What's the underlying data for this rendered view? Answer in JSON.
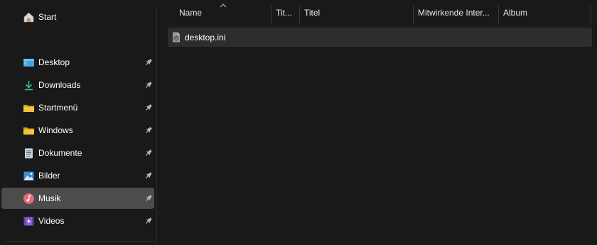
{
  "sidebar": {
    "home": {
      "label": "Start",
      "icon": "home-icon"
    },
    "items": [
      {
        "label": "Desktop",
        "icon": "desktop-icon",
        "pinned": true,
        "selected": false
      },
      {
        "label": "Downloads",
        "icon": "download-icon",
        "pinned": true,
        "selected": false
      },
      {
        "label": "Startmenü",
        "icon": "folder-icon",
        "pinned": true,
        "selected": false
      },
      {
        "label": "Windows",
        "icon": "folder-icon",
        "pinned": true,
        "selected": false
      },
      {
        "label": "Dokumente",
        "icon": "documents-icon",
        "pinned": true,
        "selected": false
      },
      {
        "label": "Bilder",
        "icon": "pictures-icon",
        "pinned": true,
        "selected": false
      },
      {
        "label": "Musik",
        "icon": "music-icon",
        "pinned": true,
        "selected": true
      },
      {
        "label": "Videos",
        "icon": "videos-icon",
        "pinned": true,
        "selected": false
      }
    ]
  },
  "columns": {
    "name": "Name",
    "track_number": "Tit...",
    "title": "Titel",
    "contributing_artists": "Mitwirkende Inter...",
    "album": "Album",
    "sort": "ascending"
  },
  "files": [
    {
      "name": "desktop.ini",
      "icon": "settings-file-icon"
    }
  ],
  "colors": {
    "background": "#191919",
    "selected_nav": "#4c4c4c",
    "file_row_highlight": "#2d2d2d",
    "folder_yellow": "#f4c542",
    "download_green": "#3fbf7f",
    "music_pink": "#e06c75",
    "videos_purple": "#8e5bd6",
    "pictures_blue": "#3b8ed6"
  }
}
